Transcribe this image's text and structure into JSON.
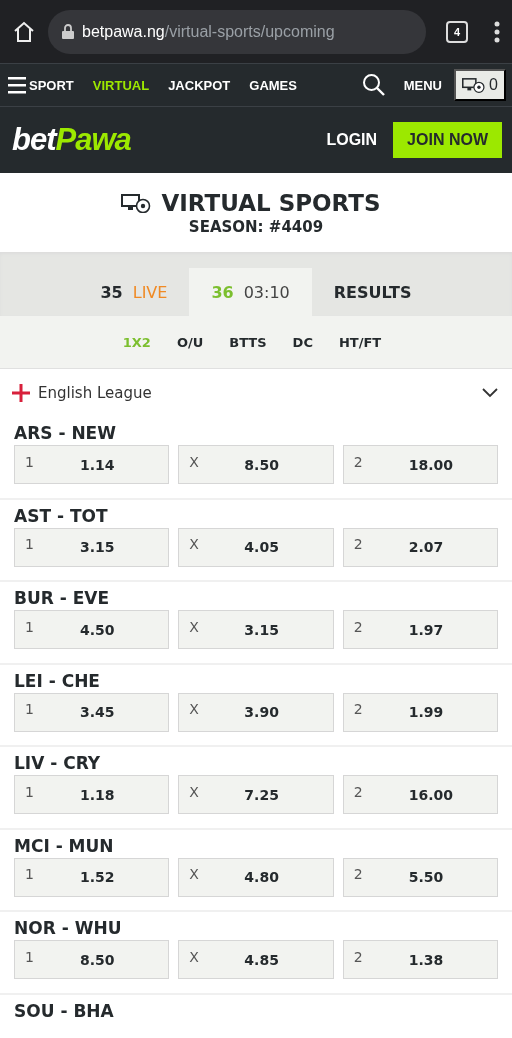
{
  "browser": {
    "url_host": "betpawa.ng",
    "url_path": "/virtual-sports/upcoming",
    "tab_count": "4"
  },
  "nav": {
    "items": [
      {
        "label": "SPORT",
        "selected": false
      },
      {
        "label": "VIRTUAL",
        "selected": true
      },
      {
        "label": "JACKPOT",
        "selected": false
      },
      {
        "label": "GAMES",
        "selected": false
      }
    ],
    "menu": "MENU",
    "betslip_count": "0"
  },
  "brand": {
    "logo_a": "bet",
    "logo_b": "Pawa",
    "login": "LOGIN",
    "join": "JOIN NOW"
  },
  "header": {
    "title": "VIRTUAL SPORTS",
    "season": "SEASON: #4409"
  },
  "tabs": [
    {
      "number": "35",
      "label": "LIVE",
      "kind": "live",
      "selected": false
    },
    {
      "number": "36",
      "label": "03:10",
      "kind": "round",
      "selected": true
    },
    {
      "label": "RESULTS",
      "kind": "results",
      "selected": false
    }
  ],
  "markets": [
    {
      "label": "1X2",
      "selected": true
    },
    {
      "label": "O/U",
      "selected": false
    },
    {
      "label": "BTTS",
      "selected": false
    },
    {
      "label": "DC",
      "selected": false
    },
    {
      "label": "HT/FT",
      "selected": false
    }
  ],
  "league": {
    "name": "English League",
    "expanded": false
  },
  "matches": [
    {
      "title": "ARS - NEW",
      "odds": [
        {
          "pick": "1",
          "price": "1.14"
        },
        {
          "pick": "X",
          "price": "8.50"
        },
        {
          "pick": "2",
          "price": "18.00"
        }
      ]
    },
    {
      "title": "AST - TOT",
      "odds": [
        {
          "pick": "1",
          "price": "3.15"
        },
        {
          "pick": "X",
          "price": "4.05"
        },
        {
          "pick": "2",
          "price": "2.07"
        }
      ]
    },
    {
      "title": "BUR - EVE",
      "odds": [
        {
          "pick": "1",
          "price": "4.50"
        },
        {
          "pick": "X",
          "price": "3.15"
        },
        {
          "pick": "2",
          "price": "1.97"
        }
      ]
    },
    {
      "title": "LEI - CHE",
      "odds": [
        {
          "pick": "1",
          "price": "3.45"
        },
        {
          "pick": "X",
          "price": "3.90"
        },
        {
          "pick": "2",
          "price": "1.99"
        }
      ]
    },
    {
      "title": "LIV - CRY",
      "odds": [
        {
          "pick": "1",
          "price": "1.18"
        },
        {
          "pick": "X",
          "price": "7.25"
        },
        {
          "pick": "2",
          "price": "16.00"
        }
      ]
    },
    {
      "title": "MCI - MUN",
      "odds": [
        {
          "pick": "1",
          "price": "1.52"
        },
        {
          "pick": "X",
          "price": "4.80"
        },
        {
          "pick": "2",
          "price": "5.50"
        }
      ]
    },
    {
      "title": "NOR - WHU",
      "odds": [
        {
          "pick": "1",
          "price": "8.50"
        },
        {
          "pick": "X",
          "price": "4.85"
        },
        {
          "pick": "2",
          "price": "1.38"
        }
      ]
    },
    {
      "title": "SOU - BHA"
    }
  ]
}
